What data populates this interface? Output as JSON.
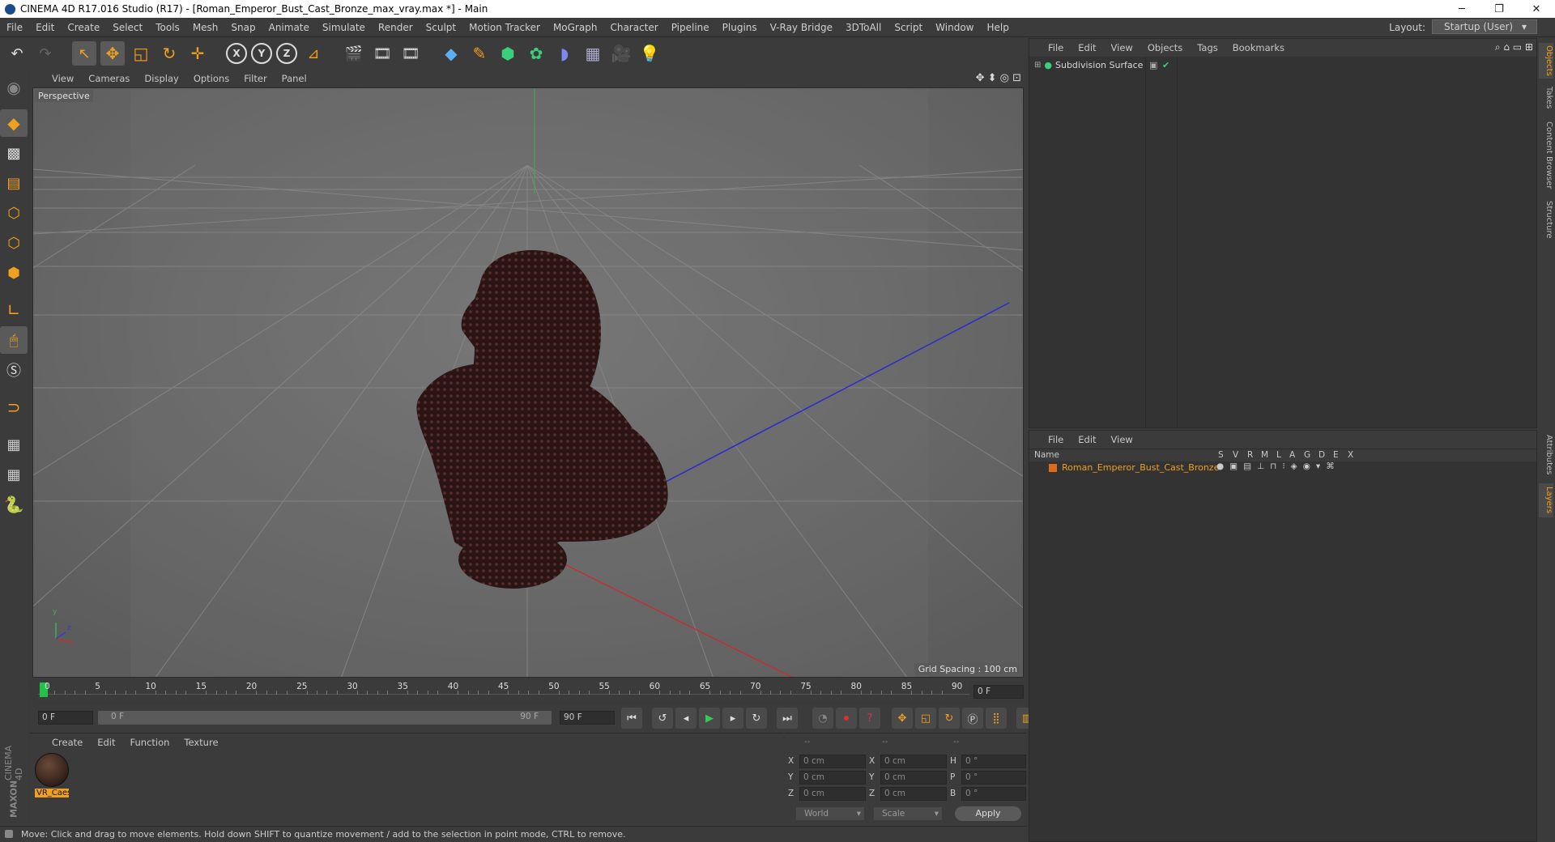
{
  "window": {
    "title": "CINEMA 4D R17.016 Studio (R17) - [Roman_Emperor_Bust_Cast_Bronze_max_vray.max *] - Main",
    "controls": {
      "minimize": "─",
      "restore": "❐",
      "close": "✕"
    }
  },
  "menubar": {
    "items": [
      "File",
      "Edit",
      "Create",
      "Select",
      "Tools",
      "Mesh",
      "Snap",
      "Animate",
      "Simulate",
      "Render",
      "Sculpt",
      "Motion Tracker",
      "MoGraph",
      "Character",
      "Pipeline",
      "Plugins",
      "V-Ray Bridge",
      "3DToAll",
      "Script",
      "Window",
      "Help"
    ],
    "layout_label": "Layout:",
    "layout_value": "Startup (User)"
  },
  "toolbar": {
    "axis_x": "X",
    "axis_y": "Y",
    "axis_z": "Z"
  },
  "viewport": {
    "menu": [
      "View",
      "Cameras",
      "Display",
      "Options",
      "Filter",
      "Panel"
    ],
    "label": "Perspective",
    "grid_spacing": "Grid Spacing : 100 cm",
    "axis_y": "y",
    "axis_x": "x",
    "axis_z": "z"
  },
  "timeline": {
    "ticks": [
      "0",
      "5",
      "10",
      "15",
      "20",
      "25",
      "30",
      "35",
      "40",
      "45",
      "50",
      "55",
      "60",
      "65",
      "70",
      "75",
      "80",
      "85",
      "90"
    ],
    "current_frame": "0 F",
    "start": "0 F",
    "range_start": "0 F",
    "range_end": "90 F",
    "end": "90 F"
  },
  "materials": {
    "menu": [
      "Create",
      "Edit",
      "Function",
      "Texture"
    ],
    "items": [
      {
        "name": "VR_Caes"
      }
    ]
  },
  "coords": {
    "headers": [
      "--",
      "--",
      "--"
    ],
    "rows": [
      {
        "a": "X",
        "av": "0 cm",
        "b": "X",
        "bv": "0 cm",
        "c": "H",
        "cv": "0 °"
      },
      {
        "a": "Y",
        "av": "0 cm",
        "b": "Y",
        "bv": "0 cm",
        "c": "P",
        "cv": "0 °"
      },
      {
        "a": "Z",
        "av": "0 cm",
        "b": "Z",
        "bv": "0 cm",
        "c": "B",
        "cv": "0 °"
      }
    ],
    "mode": "World",
    "scale": "Scale",
    "apply": "Apply"
  },
  "objects": {
    "menu": [
      "File",
      "Edit",
      "View",
      "Objects",
      "Tags",
      "Bookmarks"
    ],
    "items": [
      {
        "name": "Subdivision Surface"
      }
    ]
  },
  "layers": {
    "menu": [
      "File",
      "Edit",
      "View"
    ],
    "name_header": "Name",
    "columns": [
      "S",
      "V",
      "R",
      "M",
      "L",
      "A",
      "G",
      "D",
      "E",
      "X"
    ],
    "items": [
      {
        "name": "Roman_Emperor_Bust_Cast_Bronze",
        "color": "#e06a1c"
      }
    ]
  },
  "sidetabs": [
    "Objects",
    "Takes",
    "Content Browser",
    "Structure",
    "Attributes",
    "Layers"
  ],
  "brand": {
    "maxon": "MAXON",
    "cinema": "CINEMA 4D"
  },
  "status": {
    "text": "Move: Click and drag to move elements. Hold down SHIFT to quantize movement / add to the selection in point mode, CTRL to remove."
  }
}
